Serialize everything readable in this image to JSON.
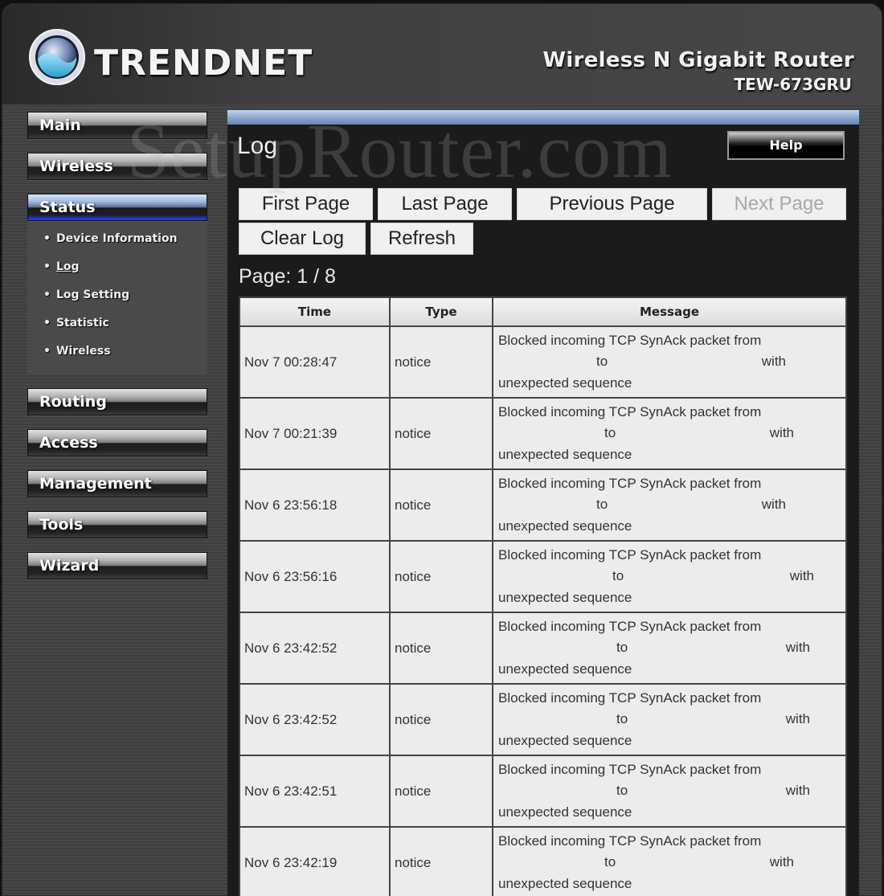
{
  "brand": {
    "logo_text": "TRENDNET",
    "product_title": "Wireless N Gigabit Router",
    "product_model": "TEW-673GRU",
    "logo_icon": "trendnet-globe-icon"
  },
  "watermark": "SetupRouter.com",
  "sidebar": {
    "items": [
      {
        "label": "Main",
        "active": false
      },
      {
        "label": "Wireless",
        "active": false
      },
      {
        "label": "Status",
        "active": true
      },
      {
        "label": "Routing",
        "active": false
      },
      {
        "label": "Access",
        "active": false
      },
      {
        "label": "Management",
        "active": false
      },
      {
        "label": "Tools",
        "active": false
      },
      {
        "label": "Wizard",
        "active": false
      }
    ],
    "status_subitems": [
      {
        "label": "Device Information",
        "current": false
      },
      {
        "label": "Log",
        "current": true
      },
      {
        "label": "Log Setting",
        "current": false
      },
      {
        "label": "Statistic",
        "current": false
      },
      {
        "label": "Wireless",
        "current": false
      }
    ],
    "bullet": "•"
  },
  "panel": {
    "title": "Log",
    "help_label": "Help",
    "buttons": {
      "first_page": "First Page",
      "last_page": "Last Page",
      "previous_page": "Previous Page",
      "next_page": "Next Page",
      "clear_log": "Clear Log",
      "refresh": "Refresh"
    },
    "page_indicator": "Page: 1 / 8",
    "table": {
      "columns": [
        "Time",
        "Type",
        "Message"
      ],
      "rows": [
        {
          "time": "Nov 7 00:28:47",
          "type": "notice",
          "msg1": "Blocked incoming TCP SynAck packet from",
          "msg_to": "to",
          "msg_with": "with",
          "msg3": "unexpected sequence"
        },
        {
          "time": "Nov 7 00:21:39",
          "type": "notice",
          "msg1": "Blocked incoming TCP SynAck packet from",
          "msg_to": "to",
          "msg_with": "with",
          "msg3": "unexpected sequence"
        },
        {
          "time": "Nov 6 23:56:18",
          "type": "notice",
          "msg1": "Blocked incoming TCP SynAck packet from",
          "msg_to": "to",
          "msg_with": "with",
          "msg3": "unexpected sequence"
        },
        {
          "time": "Nov 6 23:56:16",
          "type": "notice",
          "msg1": "Blocked incoming TCP SynAck packet from",
          "msg_to": "to",
          "msg_with": "with",
          "msg3": "unexpected sequence"
        },
        {
          "time": "Nov 6 23:42:52",
          "type": "notice",
          "msg1": "Blocked incoming TCP SynAck packet from",
          "msg_to": "to",
          "msg_with": "with",
          "msg3": "unexpected sequence"
        },
        {
          "time": "Nov 6 23:42:52",
          "type": "notice",
          "msg1": "Blocked incoming TCP SynAck packet from",
          "msg_to": "to",
          "msg_with": "with",
          "msg3": "unexpected sequence"
        },
        {
          "time": "Nov 6 23:42:51",
          "type": "notice",
          "msg1": "Blocked incoming TCP SynAck packet from",
          "msg_to": "to",
          "msg_with": "with",
          "msg3": "unexpected sequence"
        },
        {
          "time": "Nov 6 23:42:19",
          "type": "notice",
          "msg1": "Blocked incoming TCP SynAck packet from",
          "msg_to": "to",
          "msg_with": "with",
          "msg3": "unexpected sequence"
        }
      ]
    }
  }
}
